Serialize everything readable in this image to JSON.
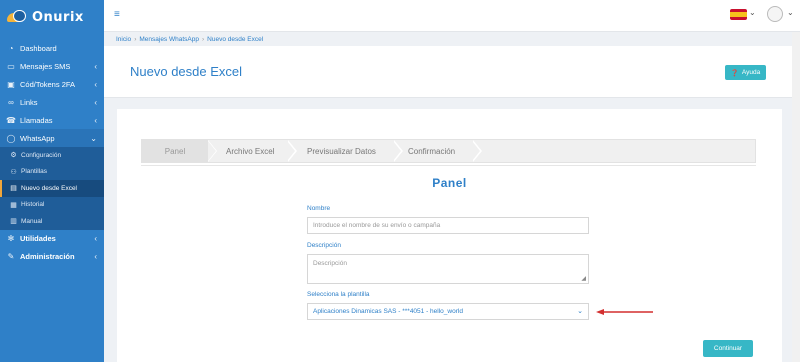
{
  "brand": {
    "name": "Onurix"
  },
  "sidebar": {
    "items": [
      {
        "label": "Dashboard",
        "icon": "dashboard-icon"
      },
      {
        "label": "Mensajes SMS",
        "icon": "message-icon"
      },
      {
        "label": "Cód/Tokens 2FA",
        "icon": "lock-icon"
      },
      {
        "label": "Links",
        "icon": "link-icon"
      },
      {
        "label": "Llamadas",
        "icon": "phone-icon"
      },
      {
        "label": "WhatsApp",
        "icon": "whatsapp-icon"
      }
    ],
    "whatsapp_sub": [
      {
        "label": "Configuración",
        "icon": "gear-icon"
      },
      {
        "label": "Plantillas",
        "icon": "template-icon"
      },
      {
        "label": "Nuevo desde Excel",
        "icon": "excel-icon"
      },
      {
        "label": "Historial",
        "icon": "history-icon"
      },
      {
        "label": "Manual",
        "icon": "book-icon"
      }
    ],
    "bottom_items": [
      {
        "label": "Utilidades",
        "icon": "tools-icon"
      },
      {
        "label": "Administración",
        "icon": "wrench-icon"
      }
    ]
  },
  "breadcrumb": [
    "Inicio",
    "Mensajes WhatsApp",
    "Nuevo desde Excel"
  ],
  "page_title": "Nuevo desde Excel",
  "help_button": "Ayuda",
  "wizard": {
    "steps": [
      "Panel",
      "Archivo Excel",
      "Previsualizar Datos",
      "Confirmación"
    ]
  },
  "panel_title": "Panel",
  "form": {
    "name_label": "Nombre",
    "name_placeholder": "Introduce el nombre de su envío o campaña",
    "desc_label": "Descripción",
    "desc_placeholder": "Descripción",
    "template_label": "Selecciona la plantilla",
    "template_value": "Aplicaciones Dinamicas SAS - ***4051 - hello_world"
  },
  "continue_button": "Continuar",
  "colors": {
    "primary": "#2f80c8",
    "accent": "#37b7c6",
    "arrow": "#d32f2f"
  }
}
